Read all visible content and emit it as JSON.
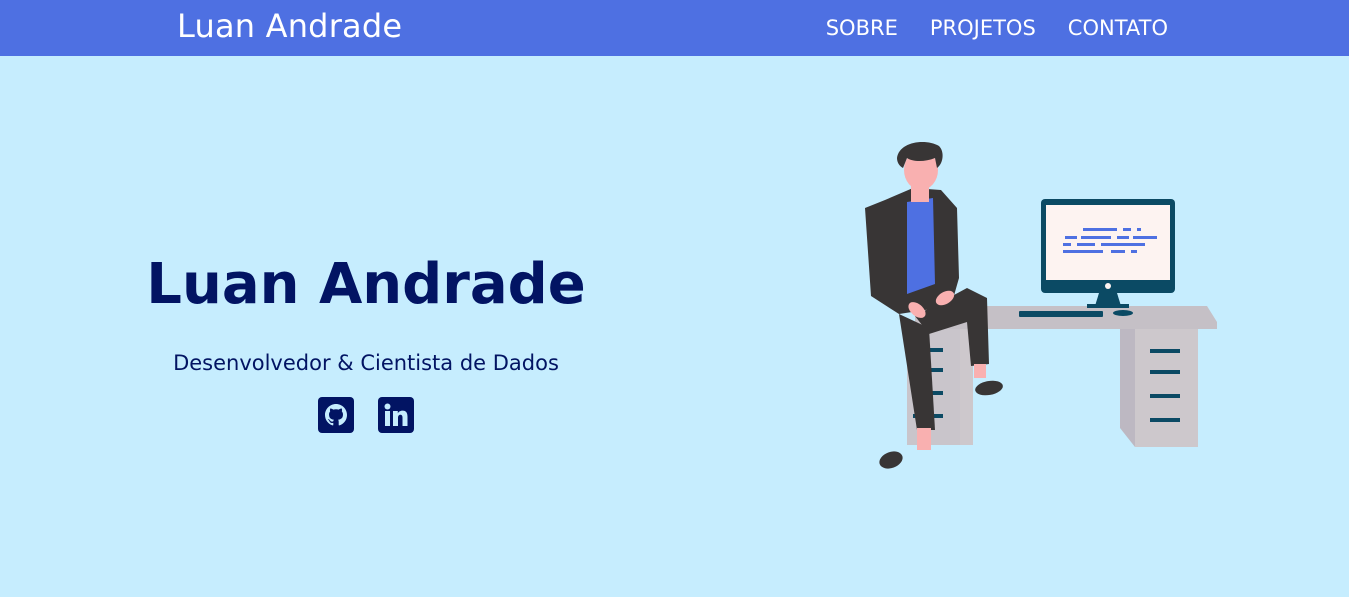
{
  "header": {
    "brand": "Luan Andrade",
    "nav": [
      {
        "label": "SOBRE"
      },
      {
        "label": "PROJETOS"
      },
      {
        "label": "CONTATO"
      }
    ]
  },
  "hero": {
    "title": "Luan Andrade",
    "subtitle": "Desenvolvedor & Cientista de Dados",
    "socials": [
      {
        "icon": "github-icon"
      },
      {
        "icon": "linkedin-icon"
      }
    ],
    "illustration": "developer-at-desk"
  },
  "colors": {
    "navbar": "#4e70e2",
    "background": "#c6edfe",
    "primary_text": "#021463",
    "nav_text": "#ffffff"
  }
}
